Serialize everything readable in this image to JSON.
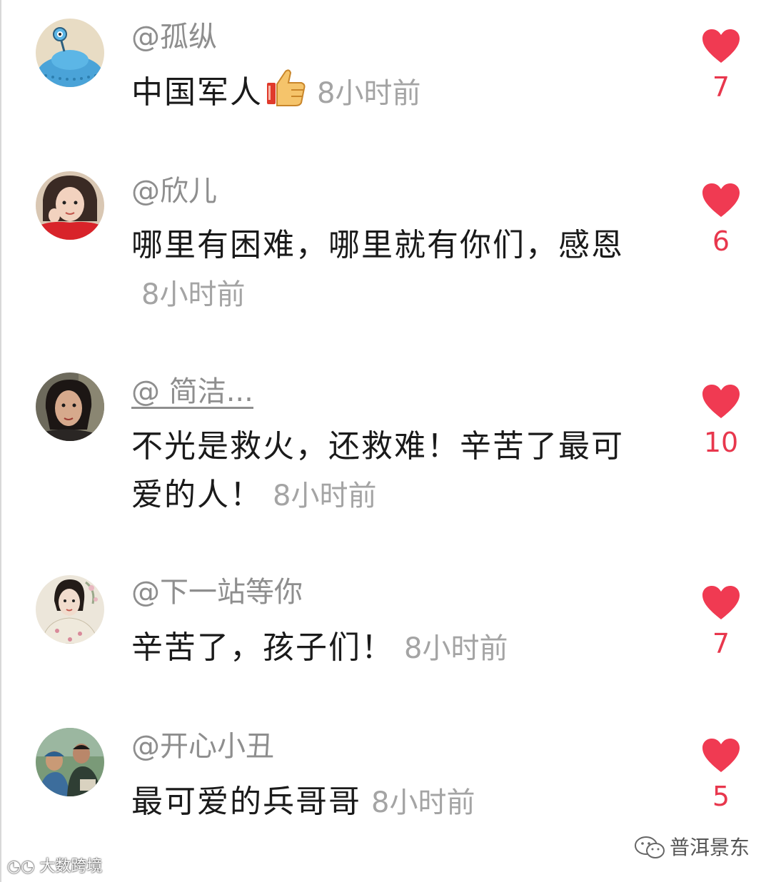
{
  "comments": [
    {
      "username": "@孤纵",
      "text": "中国军人",
      "has_thumb": true,
      "time": "8小时前",
      "likes": "7",
      "avatar": "cartoon-alien-avatar"
    },
    {
      "username": "@欣儿",
      "text": "哪里有困难，哪里就有你们，感恩",
      "time": "8小时前",
      "likes": "6",
      "avatar": "woman-red-sweater-avatar"
    },
    {
      "username": "@ 简洁...",
      "text": "不光是救火，还救难！辛苦了最可爱的人！",
      "time": "8小时前",
      "likes": "10",
      "avatar": "woman-portrait-avatar"
    },
    {
      "username": "@下一站等你",
      "text": "辛苦了，孩子们！",
      "time": "8小时前",
      "likes": "7",
      "avatar": "woman-qipao-avatar"
    },
    {
      "username": "@开心小丑",
      "text": "最可爱的兵哥哥",
      "time": "8小时前",
      "likes": "5",
      "avatar": "group-photo-avatar"
    }
  ],
  "watermarks": {
    "left": "大数跨境",
    "right": "普洱景东"
  },
  "colors": {
    "heart": "#f03a52",
    "like_count": "#e8374d",
    "username": "#8e8e8e",
    "time": "#a4a4a4",
    "text": "#1a1a1a"
  }
}
